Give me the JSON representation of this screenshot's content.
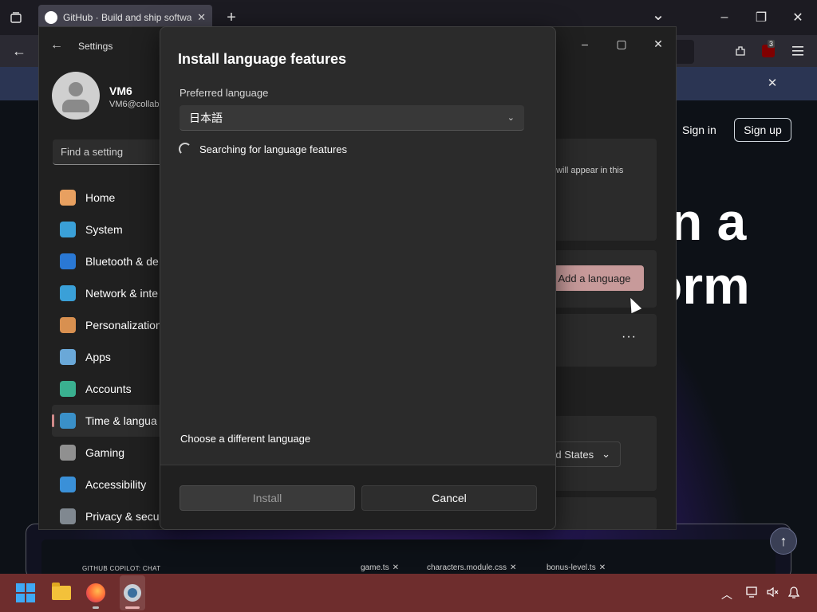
{
  "browser": {
    "tab_title": "GitHub · Build and ship software",
    "tab_close": "✕",
    "new_tab": "+",
    "tab_list": "⌄",
    "back": "←",
    "min": "–",
    "restore": "❐",
    "close": "✕",
    "ublock_count": "3",
    "notif_close": "✕"
  },
  "github": {
    "sign_in": "Sign in",
    "sign_up": "Sign up",
    "hero_1": "n a",
    "hero_2": "orm",
    "copilot_label": "GITHUB COPILOT: CHAT",
    "files": [
      "game.ts",
      "characters.module.css",
      "bonus-level.ts"
    ],
    "scroll_top": "↑"
  },
  "settings": {
    "title": "Settings",
    "back": "←",
    "user_name": "VM6",
    "user_email": "VM6@collab",
    "find_placeholder": "Find a setting",
    "nav": [
      {
        "label": "Home",
        "color": "#e8a060"
      },
      {
        "label": "System",
        "color": "#3aa0d8"
      },
      {
        "label": "Bluetooth & de",
        "color": "#2a78d4"
      },
      {
        "label": "Network & inte",
        "color": "#3aa0d8"
      },
      {
        "label": "Personalization",
        "color": "#d89050"
      },
      {
        "label": "Apps",
        "color": "#6aa8d8"
      },
      {
        "label": "Accounts",
        "color": "#3ab090"
      },
      {
        "label": "Time & langua",
        "color": "#3a90c8"
      },
      {
        "label": "Gaming",
        "color": "#909090"
      },
      {
        "label": "Accessibility",
        "color": "#3a90d8"
      },
      {
        "label": "Privacy & secu",
        "color": "#808890"
      }
    ],
    "partial_text": "will appear in this",
    "add_language": "Add a language",
    "more": "···",
    "region_value": "d States"
  },
  "dialog": {
    "title": "Install language features",
    "preferred_label": "Preferred language",
    "selected_language": "日本語",
    "chevron": "⌄",
    "status": "Searching for language features",
    "choose_link": "Choose a different language",
    "install": "Install",
    "cancel": "Cancel"
  },
  "taskbar": {
    "tray_up": "︿",
    "bell": "🔔"
  }
}
